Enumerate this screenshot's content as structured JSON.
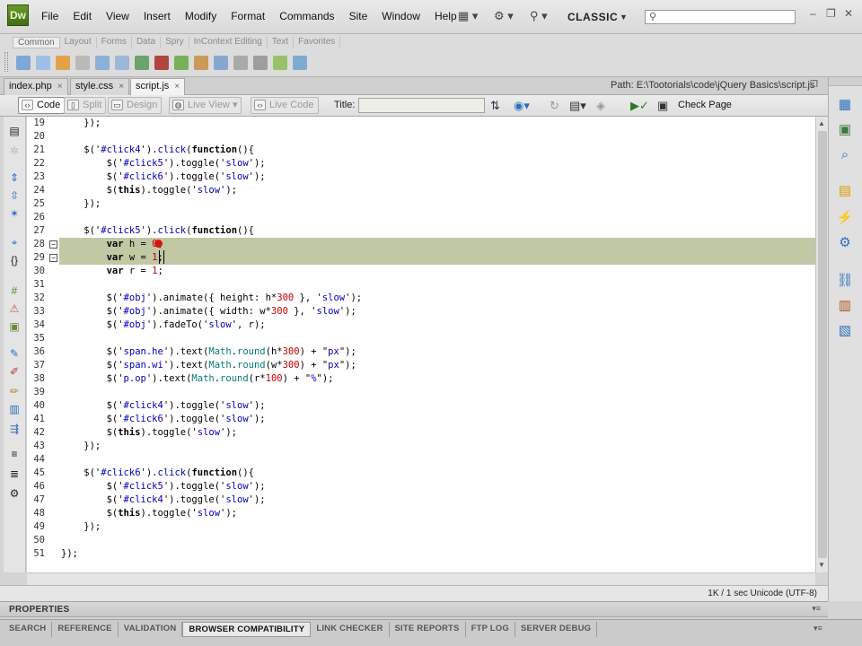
{
  "app": {
    "logo": "Dw",
    "workspace": "CLASSIC"
  },
  "menu": [
    "File",
    "Edit",
    "View",
    "Insert",
    "Modify",
    "Format",
    "Commands",
    "Site",
    "Window",
    "Help"
  ],
  "insert_panel": {
    "tabs": [
      "Common",
      "Layout",
      "Forms",
      "Data",
      "Spry",
      "InContext Editing",
      "Text",
      "Favorites"
    ],
    "active_tab": "Common"
  },
  "documents": {
    "tabs": [
      {
        "label": "index.php",
        "close": "×"
      },
      {
        "label": "style.css",
        "close": "×"
      },
      {
        "label": "script.js",
        "close": "×"
      }
    ],
    "active": 2,
    "path": "Path:  E:\\Tootorials\\code\\jQuery Basics\\script.js"
  },
  "doc_toolbar": {
    "code": "Code",
    "split": "Split",
    "design": "Design",
    "live_view": "Live View",
    "live_code": "Live Code",
    "title_label": "Title:",
    "title_value": "",
    "check_page": "Check Page"
  },
  "code": {
    "highlight_lines": [
      28,
      29
    ],
    "lines": [
      {
        "n": "19",
        "html": "    });"
      },
      {
        "n": "20",
        "html": ""
      },
      {
        "n": "21",
        "html": "    $('<span class=\"s\">#click4</span>').<span class=\"f\">click</span>(<span class=\"k\">function</span>(){"
      },
      {
        "n": "22",
        "html": "        $('<span class=\"s\">#click5</span>').toggle('<span class=\"s\">slow</span>');"
      },
      {
        "n": "23",
        "html": "        $('<span class=\"s\">#click6</span>').toggle('<span class=\"s\">slow</span>');"
      },
      {
        "n": "24",
        "html": "        $(<span class=\"k\">this</span>).toggle('<span class=\"s\">slow</span>');"
      },
      {
        "n": "25",
        "html": "    });"
      },
      {
        "n": "26",
        "html": ""
      },
      {
        "n": "27",
        "html": "    $('<span class=\"s\">#click5</span>').<span class=\"f\">click</span>(<span class=\"k\">function</span>(){"
      },
      {
        "n": "28",
        "html": "        <span class=\"k\">var</span> h = <span class=\"n\">0</span>;"
      },
      {
        "n": "29",
        "html": "        <span class=\"k\">var</span> w = <span class=\"n\">1</span>;"
      },
      {
        "n": "30",
        "html": "        <span class=\"k\">var</span> r = <span class=\"n\">1</span>;"
      },
      {
        "n": "31",
        "html": ""
      },
      {
        "n": "32",
        "html": "        $('<span class=\"s\">#obj</span>').animate({ height: h*<span class=\"n\">300</span> }, '<span class=\"s\">slow</span>');"
      },
      {
        "n": "33",
        "html": "        $('<span class=\"s\">#obj</span>').animate({ width: w*<span class=\"n\">300</span> }, '<span class=\"s\">slow</span>');"
      },
      {
        "n": "34",
        "html": "        $('<span class=\"s\">#obj</span>').fadeTo('<span class=\"s\">slow</span>', r);"
      },
      {
        "n": "35",
        "html": ""
      },
      {
        "n": "36",
        "html": "        $('<span class=\"s\">span.he</span>').text(<span class=\"m\">Math</span>.<span class=\"m\">round</span>(h*<span class=\"n\">300</span>) + \"<span class=\"s\">px</span>\");"
      },
      {
        "n": "37",
        "html": "        $('<span class=\"s\">span.wi</span>').text(<span class=\"m\">Math</span>.<span class=\"m\">round</span>(w*<span class=\"n\">300</span>) + \"<span class=\"s\">px</span>\");"
      },
      {
        "n": "38",
        "html": "        $('<span class=\"s\">p.op</span>').text(<span class=\"m\">Math</span>.<span class=\"m\">round</span>(r*<span class=\"n\">100</span>) + \"<span class=\"s\">%</span>\");"
      },
      {
        "n": "39",
        "html": ""
      },
      {
        "n": "40",
        "html": "        $('<span class=\"s\">#click4</span>').toggle('<span class=\"s\">slow</span>');"
      },
      {
        "n": "41",
        "html": "        $('<span class=\"s\">#click6</span>').toggle('<span class=\"s\">slow</span>');"
      },
      {
        "n": "42",
        "html": "        $(<span class=\"k\">this</span>).toggle('<span class=\"s\">slow</span>');"
      },
      {
        "n": "43",
        "html": "    });"
      },
      {
        "n": "44",
        "html": ""
      },
      {
        "n": "45",
        "html": "    $('<span class=\"s\">#click6</span>').<span class=\"f\">click</span>(<span class=\"k\">function</span>(){"
      },
      {
        "n": "46",
        "html": "        $('<span class=\"s\">#click5</span>').toggle('<span class=\"s\">slow</span>');"
      },
      {
        "n": "47",
        "html": "        $('<span class=\"s\">#click4</span>').toggle('<span class=\"s\">slow</span>');"
      },
      {
        "n": "48",
        "html": "        $(<span class=\"k\">this</span>).toggle('<span class=\"s\">slow</span>');"
      },
      {
        "n": "49",
        "html": "    });"
      },
      {
        "n": "50",
        "html": ""
      },
      {
        "n": "51",
        "html": "});"
      }
    ]
  },
  "status": {
    "text": "1K / 1 sec  Unicode (UTF-8)"
  },
  "properties": {
    "label": "PROPERTIES"
  },
  "results_tabs": {
    "items": [
      "SEARCH",
      "REFERENCE",
      "VALIDATION",
      "BROWSER COMPATIBILITY",
      "LINK CHECKER",
      "SITE REPORTS",
      "FTP LOG",
      "SERVER DEBUG"
    ],
    "active": "BROWSER COMPATIBILITY"
  },
  "colors": {
    "line_highlight": "#c0c8a4",
    "string": "#0000b5",
    "number": "#c40000",
    "math": "#0a7a7a",
    "logo": "#3f6d13"
  }
}
